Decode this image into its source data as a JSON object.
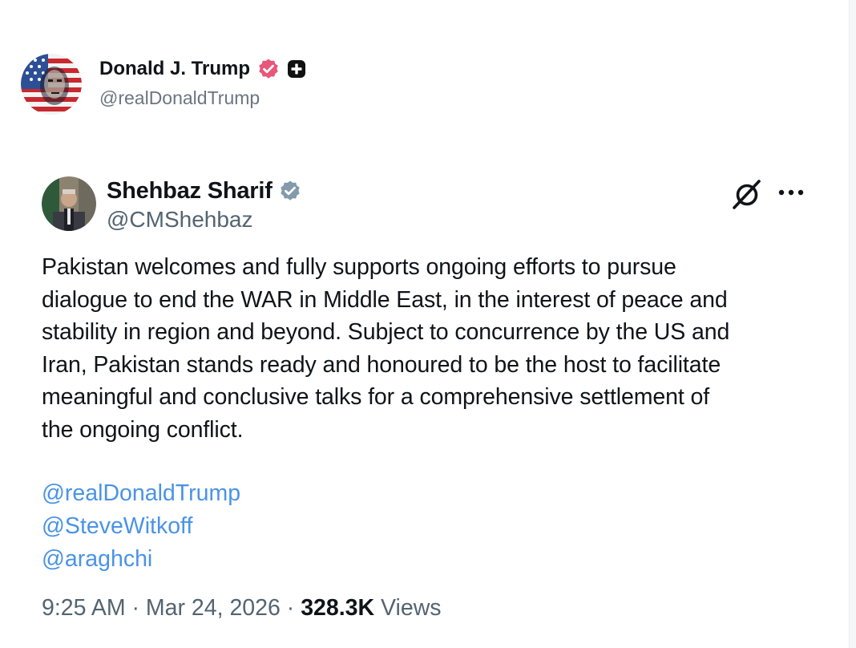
{
  "outer_author": {
    "name": "Donald J. Trump",
    "handle": "@realDonaldTrump"
  },
  "quoted_post": {
    "author_name": "Shehbaz Sharif",
    "author_handle": "@CMShehbaz",
    "text": "Pakistan welcomes and fully supports ongoing efforts to pursue\ndialogue to end the WAR in Middle East, in the interest of peace and\nstability in region and beyond. Subject to concurrence by the US and\nIran, Pakistan stands ready and honoured to be the host to facilitate\nmeaningful and conclusive talks for a comprehensive settlement of\nthe ongoing conflict.",
    "mentions": [
      "@realDonaldTrump",
      "@SteveWitkoff",
      "@araghchi"
    ],
    "time": "9:25 AM",
    "separator": " · ",
    "date": "Mar 24, 2026",
    "views_count": "328.3K",
    "views_label": " Views"
  },
  "icons": {
    "verified_outer": "verified-badge-icon",
    "plus": "plus-badge-icon",
    "verified_inner": "verified-badge-icon",
    "grok": "grok-icon",
    "more": "more-options-icon"
  },
  "colors": {
    "text_primary": "#0f1419",
    "text_secondary": "#536471",
    "mention_link": "#4a93e6",
    "verified_outer": "#e8567a",
    "verified_inner": "#829aab"
  }
}
